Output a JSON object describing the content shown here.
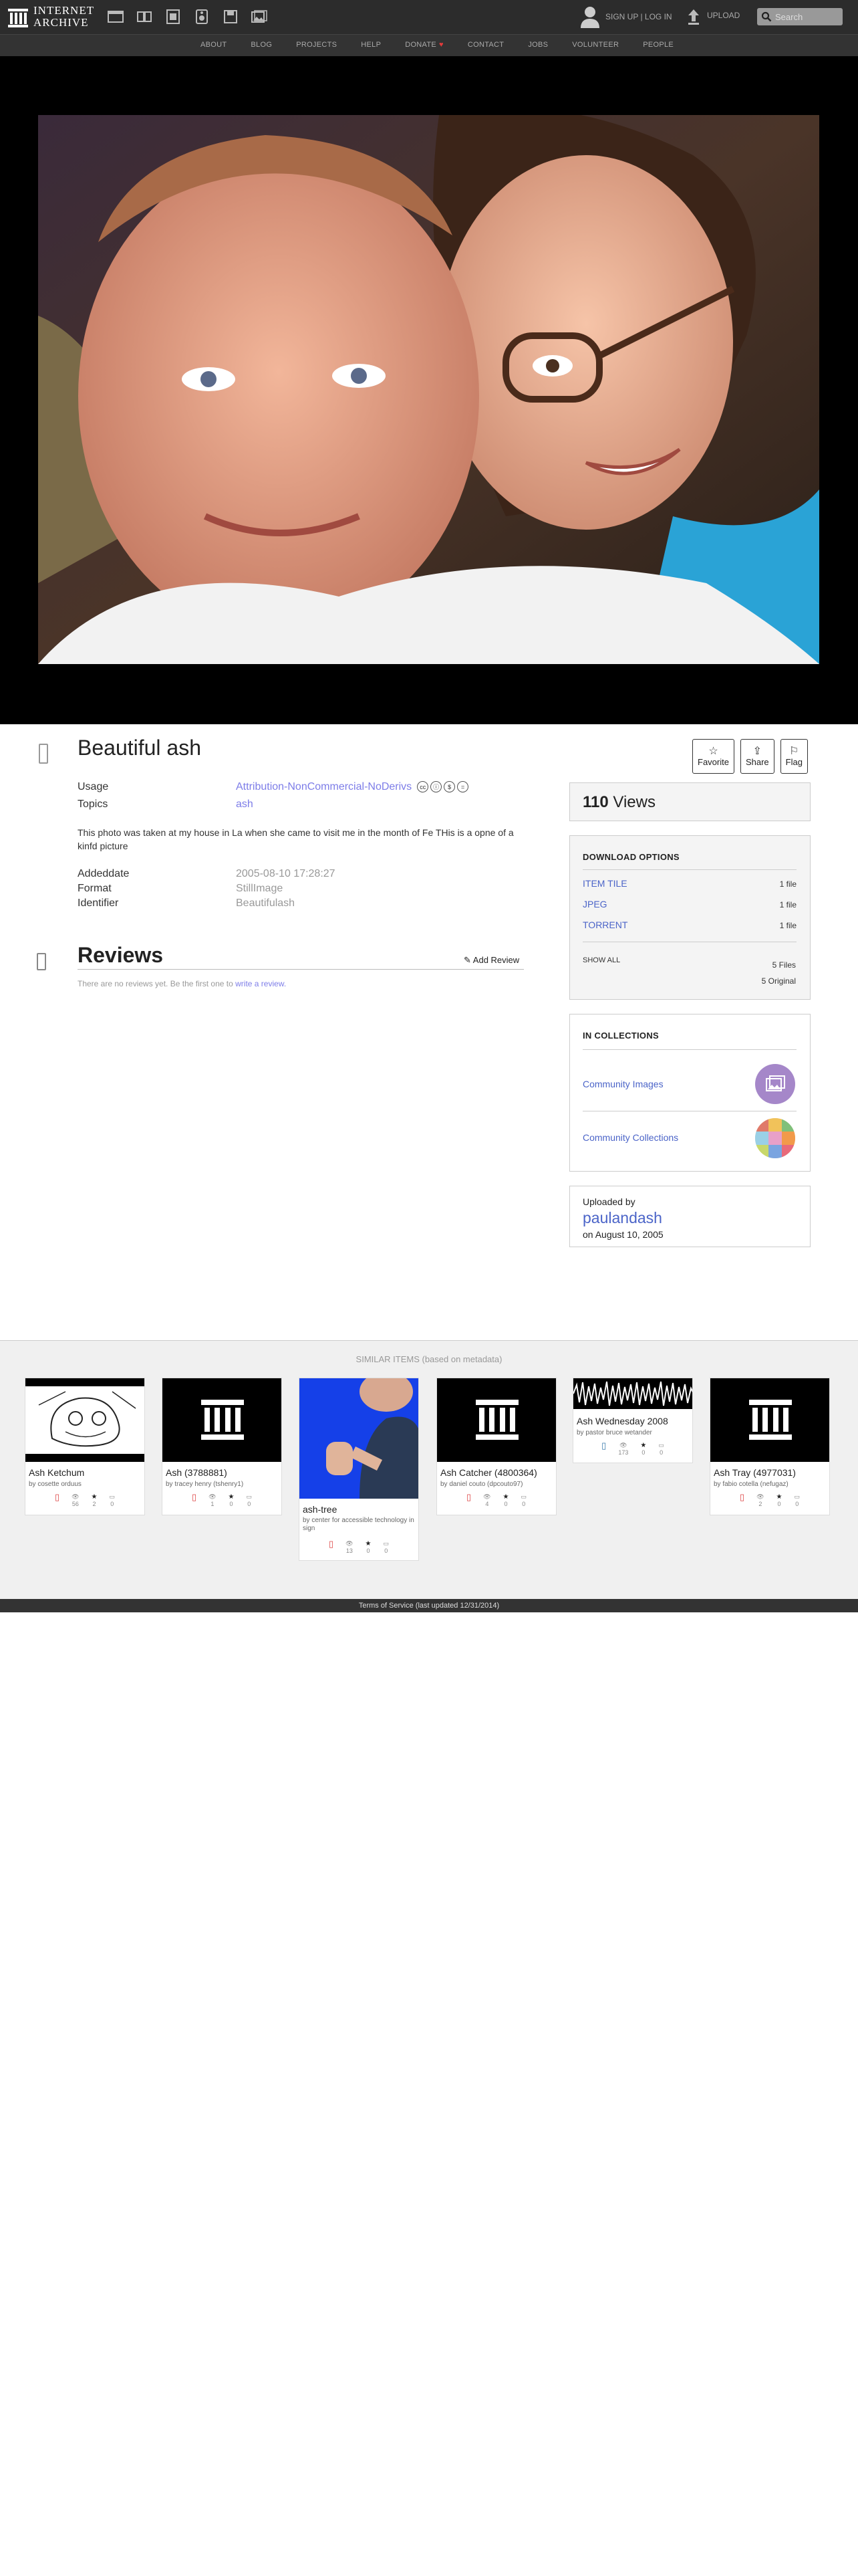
{
  "header": {
    "logo_line1": "INTERNET",
    "logo_line2": "ARCHIVE",
    "signup": "SIGN UP | LOG IN",
    "upload": "UPLOAD",
    "search_placeholder": "Search"
  },
  "subnav": [
    "ABOUT",
    "BLOG",
    "PROJECTS",
    "HELP",
    "DONATE",
    "CONTACT",
    "JOBS",
    "VOLUNTEER",
    "PEOPLE"
  ],
  "item": {
    "title": "Beautiful ash",
    "actions": [
      {
        "icon": "star-icon",
        "label": "Favorite"
      },
      {
        "icon": "share-icon",
        "label": "Share"
      },
      {
        "icon": "flag-icon",
        "label": "Flag"
      }
    ],
    "usage_label": "Usage",
    "usage_value": "Attribution-NonCommercial-NoDerivs",
    "topics_label": "Topics",
    "topics_value": "ash",
    "description": "This photo was taken at my house in La when she came to visit me in the month of Fe THis is a opne of a kinfd picture",
    "addeddate_label": "Addeddate",
    "addeddate_value": "2005-08-10 17:28:27",
    "format_label": "Format",
    "format_value": "StillImage",
    "identifier_label": "Identifier",
    "identifier_value": "Beautifulash"
  },
  "reviews": {
    "title": "Reviews",
    "add_label": "Add Review",
    "empty_text": "There are no reviews yet. Be the first one to",
    "empty_link": "write a review."
  },
  "sidebar": {
    "views_count": "110",
    "views_label": "Views",
    "download_title": "DOWNLOAD OPTIONS",
    "downloads": [
      {
        "label": "ITEM TILE",
        "count": "1 file"
      },
      {
        "label": "JPEG",
        "count": "1 file"
      },
      {
        "label": "TORRENT",
        "count": "1 file"
      }
    ],
    "show_all": "SHOW ALL",
    "files_total": "5 Files",
    "original_total": "5 Original",
    "collections_title": "IN COLLECTIONS",
    "collections": [
      "Community Images",
      "Community Collections"
    ],
    "uploaded_by_label": "Uploaded by",
    "uploader": "paulandash",
    "upload_date": "on August 10, 2005"
  },
  "similar": {
    "heading": "SIMILAR ITEMS (based on metadata)",
    "items": [
      {
        "title": "Ash Ketchum",
        "by": "by cosette orduus",
        "views": "56",
        "favs": "2",
        "reviews": "0"
      },
      {
        "title": "Ash (3788881)",
        "by": "by tracey henry (tshenry1)",
        "views": "1",
        "favs": "0",
        "reviews": "0"
      },
      {
        "title": "ash-tree",
        "by": "by center for accessible technology in sign",
        "views": "13",
        "favs": "0",
        "reviews": "0"
      },
      {
        "title": "Ash Catcher (4800364)",
        "by": "by daniel couto (dpcouto97)",
        "views": "4",
        "favs": "0",
        "reviews": "0"
      },
      {
        "title": "Ash Wednesday 2008",
        "by": "by pastor bruce wetander",
        "views": "173",
        "favs": "0",
        "reviews": "0"
      },
      {
        "title": "Ash Tray (4977031)",
        "by": "by fabio cotella (nefugaz)",
        "views": "2",
        "favs": "0",
        "reviews": "0"
      }
    ]
  },
  "footer": "Terms of Service (last updated 12/31/2014)"
}
